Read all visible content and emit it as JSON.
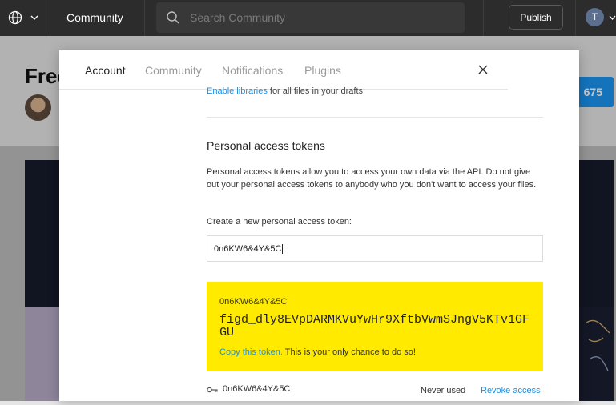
{
  "topbar": {
    "title": "Community",
    "search_placeholder": "Search Community",
    "publish_label": "Publish",
    "avatar_initial": "T",
    "icons": [
      "globe-icon",
      "chevron-down-icon",
      "search-icon"
    ]
  },
  "background": {
    "title": "Free",
    "count": "675"
  },
  "modal": {
    "tabs": [
      {
        "label": "Account",
        "active": true
      },
      {
        "label": "Community",
        "active": false
      },
      {
        "label": "Notifications",
        "active": false
      },
      {
        "label": "Plugins",
        "active": false
      }
    ],
    "libraries": {
      "link": "Enable libraries",
      "text": " for all files in your drafts"
    },
    "pat": {
      "heading": "Personal access tokens",
      "description": "Personal access tokens allow you to access your own data via the API. Do not give out your personal access tokens to anybody who you don't want to access your files.",
      "create_label": "Create a new personal access token:",
      "input_value": "0n6KW6&4Y&5C"
    },
    "new_token": {
      "name": "0n6KW6&4Y&5C",
      "value": "figd_dly8EVpDARMKVuYwHr9XftbVwmSJngV5KTv1GFGU",
      "copy_link": "Copy this token.",
      "copy_note": " This is your only chance to do so!"
    },
    "token_row": {
      "name": "0n6KW6&4Y&5C",
      "status": "Never used",
      "action": "Revoke access"
    }
  },
  "colors": {
    "topbar": "#2c2c2c",
    "accent_link": "#1a8fe3",
    "token_highlight": "#ffea00"
  }
}
